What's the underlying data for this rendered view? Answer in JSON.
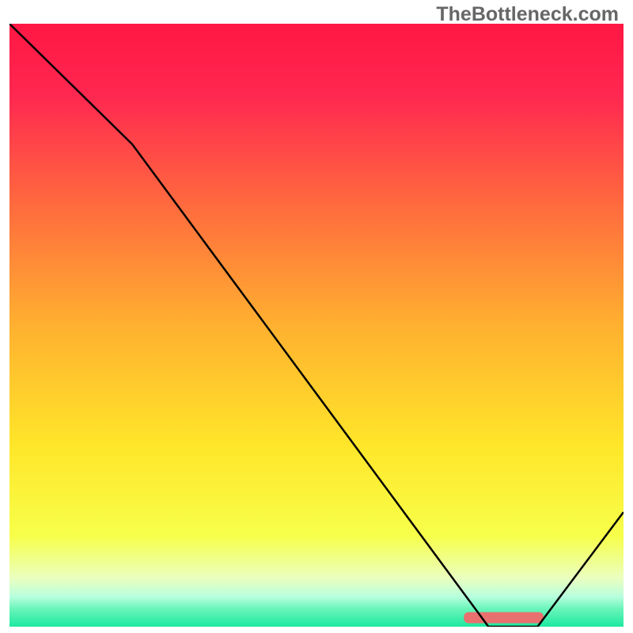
{
  "watermark": "TheBottleneck.com",
  "chart_data": {
    "type": "line",
    "title": "",
    "xlabel": "",
    "ylabel": "",
    "x": [
      0,
      0.2,
      0.78,
      0.86,
      1.0
    ],
    "values": [
      1.0,
      0.8,
      0.0,
      0.0,
      0.19
    ],
    "xlim": [
      0,
      1
    ],
    "ylim": [
      0,
      1
    ],
    "gradient_stops": [
      {
        "pos": 0.0,
        "color": "#ff1744"
      },
      {
        "pos": 0.12,
        "color": "#ff2850"
      },
      {
        "pos": 0.3,
        "color": "#ff6a3e"
      },
      {
        "pos": 0.5,
        "color": "#ffb030"
      },
      {
        "pos": 0.7,
        "color": "#ffe629"
      },
      {
        "pos": 0.85,
        "color": "#f7ff4a"
      },
      {
        "pos": 0.92,
        "color": "#eaffc0"
      },
      {
        "pos": 0.95,
        "color": "#b8ffde"
      },
      {
        "pos": 0.97,
        "color": "#6bf5ba"
      },
      {
        "pos": 1.0,
        "color": "#1de9a0"
      }
    ],
    "marker": {
      "x_start": 0.74,
      "x_end": 0.87,
      "y": 0.985,
      "color": "#e8716f"
    },
    "line_color": "#000000",
    "line_width": 2.5
  }
}
